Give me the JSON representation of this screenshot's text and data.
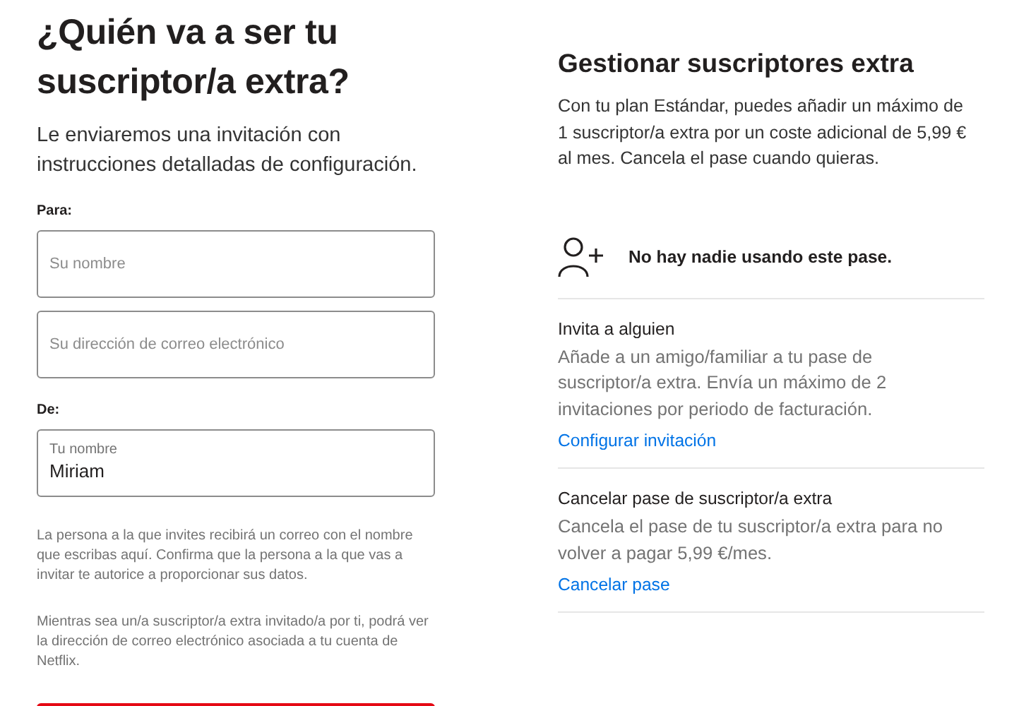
{
  "invite_form": {
    "title": "¿Quién va a ser tu suscriptor/a extra?",
    "subtitle": "Le enviaremos una invitación con instrucciones detalladas de configuración.",
    "to_label": "Para:",
    "to_fields": [
      {
        "placeholder": "Su nombre"
      },
      {
        "placeholder": "Su dirección de correo electrónico"
      }
    ],
    "from_label": "De:",
    "from_field": {
      "label": "Tu nombre",
      "value": "Miriam"
    },
    "notes": [
      "La persona a la que invites recibirá un correo con el nombre que escribas aquí. Confirma que la persona a la que vas a invitar te autorice a proporcionar sus datos.",
      "Mientras sea un/a suscriptor/a extra invitado/a por ti, podrá ver la dirección de correo electrónico asociada a tu cuenta de Netflix."
    ]
  },
  "manage": {
    "title": "Gestionar suscriptores extra",
    "description": "Con tu plan Estándar, puedes añadir un máximo de 1 suscriptor/a extra por un coste adicional de 5,99 € al mes. Cancela el pase cuando quieras.",
    "status": "No hay nadie usando este pase.",
    "sections": [
      {
        "title": "Invita a alguien",
        "description": "Añade a un amigo/familiar a tu pase de suscriptor/a extra. Envía un máximo de 2 invitaciones por periodo de facturación.",
        "link": "Configurar invitación"
      },
      {
        "title": "Cancelar pase de suscriptor/a extra",
        "description": "Cancela el pase de tu suscriptor/a extra para no volver a pagar 5,99 €/mes.",
        "link": "Cancelar pase"
      }
    ]
  }
}
